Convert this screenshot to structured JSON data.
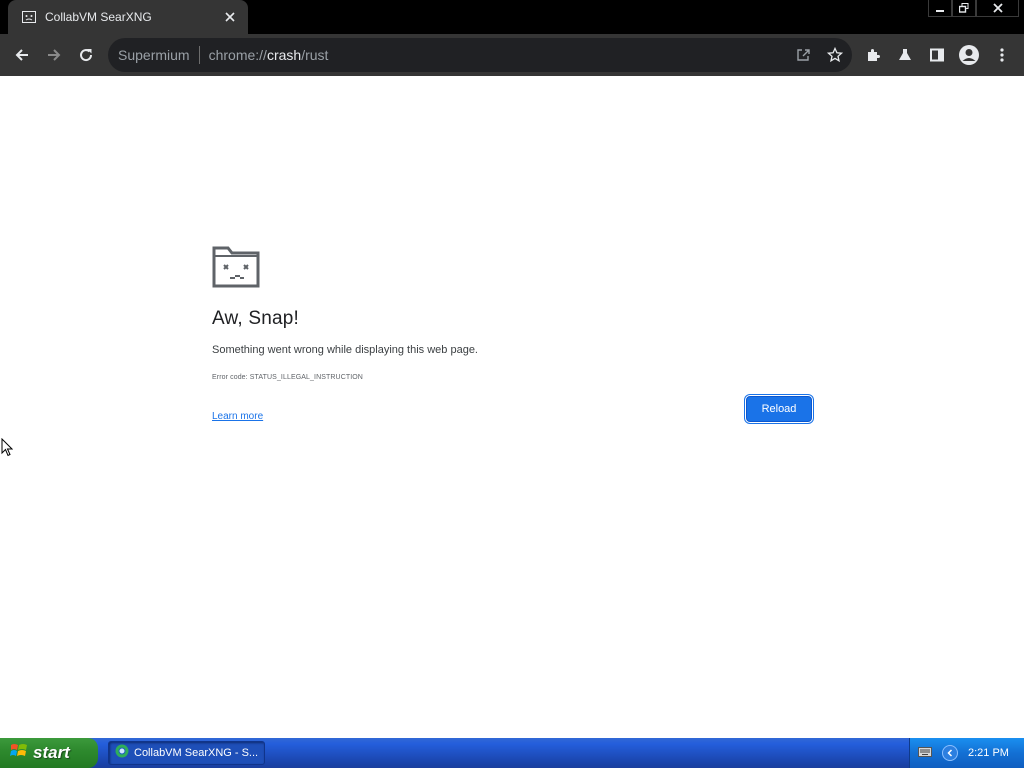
{
  "browser": {
    "tab": {
      "title": "CollabVM SearXNG",
      "favicon": "sad-page-icon"
    },
    "window_controls": [
      "minimize-icon",
      "restore-icon",
      "close-icon"
    ],
    "toolbar": {
      "back": "back-arrow-icon",
      "forward": "forward-arrow-icon",
      "reload": "reload-icon",
      "omnibox": {
        "site_label": "Supermium",
        "url_prefix": "chrome://",
        "url_host": "crash",
        "url_path": "/rust"
      },
      "right_icons": [
        "extensions-icon",
        "labs-icon",
        "side-panel-icon",
        "profile-icon",
        "menu-icon"
      ]
    }
  },
  "error_page": {
    "icon": "sad-folder-icon",
    "title": "Aw, Snap!",
    "message": "Something went wrong while displaying this web page.",
    "error_code": "Error code: STATUS_ILLEGAL_INSTRUCTION",
    "learn_more": "Learn more",
    "reload_label": "Reload"
  },
  "taskbar": {
    "start_label": "start",
    "task_item_label": "CollabVM SearXNG - S...",
    "clock": "2:21 PM"
  },
  "colors": {
    "accent": "#1a73e8",
    "chrome_bg": "#353535",
    "taskbar_blue": "#245edb",
    "start_green": "#2e8a2e"
  }
}
